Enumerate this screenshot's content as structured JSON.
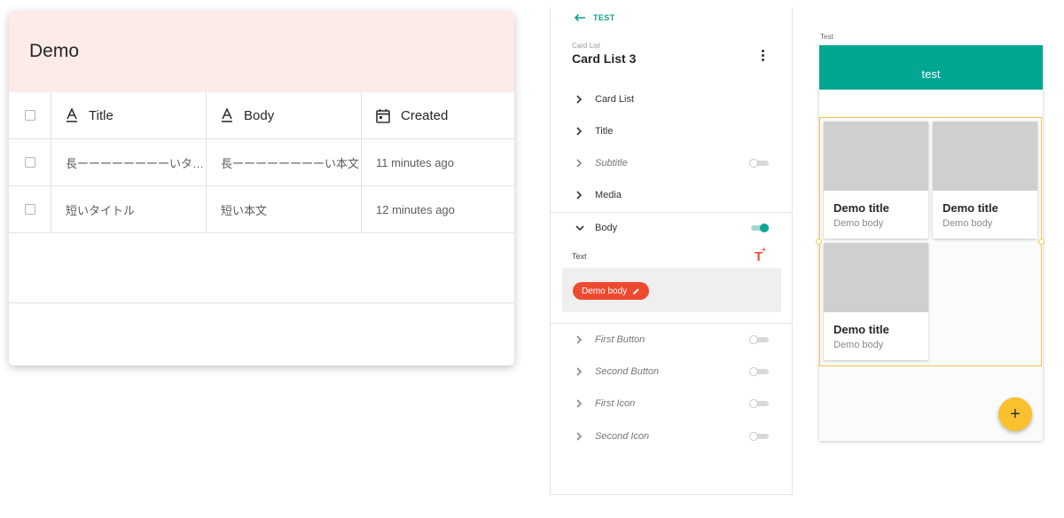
{
  "table": {
    "title": "Demo",
    "columns": [
      {
        "label": "Title",
        "icon": "text-field-icon"
      },
      {
        "label": "Body",
        "icon": "text-field-icon"
      },
      {
        "label": "Created",
        "icon": "calendar-icon"
      }
    ],
    "rows": [
      {
        "title": "長ーーーーーーーーいタ…",
        "body": "長ーーーーーーーーい本文",
        "created": "11 minutes ago"
      },
      {
        "title": "短いタイトル",
        "body": "短い本文",
        "created": "12 minutes ago"
      }
    ]
  },
  "editor": {
    "back_label": "TEST",
    "component_type": "Card List",
    "component_name": "Card List 3",
    "properties": [
      {
        "label": "Card List",
        "expanded": false,
        "disabled": false,
        "toggle": null
      },
      {
        "label": "Title",
        "expanded": false,
        "disabled": false,
        "toggle": null
      },
      {
        "label": "Subtitle",
        "expanded": false,
        "disabled": true,
        "toggle": "off"
      },
      {
        "label": "Media",
        "expanded": false,
        "disabled": false,
        "toggle": null
      },
      {
        "label": "Body",
        "expanded": true,
        "disabled": false,
        "toggle": "on"
      },
      {
        "label": "First Button",
        "expanded": false,
        "disabled": true,
        "toggle": "off"
      },
      {
        "label": "Second Button",
        "expanded": false,
        "disabled": true,
        "toggle": "off"
      },
      {
        "label": "First Icon",
        "expanded": false,
        "disabled": true,
        "toggle": "off"
      },
      {
        "label": "Second Icon",
        "expanded": false,
        "disabled": true,
        "toggle": "off"
      }
    ],
    "body_text_label": "Text",
    "body_chip": "Demo body"
  },
  "preview": {
    "screen_label": "Test",
    "app_bar_title": "test",
    "cards": [
      {
        "title": "Demo title",
        "body": "Demo body"
      },
      {
        "title": "Demo title",
        "body": "Demo body"
      },
      {
        "title": "Demo title",
        "body": "Demo body"
      }
    ],
    "fab_symbol": "+"
  },
  "colors": {
    "table_header_bg": "#fcebe8",
    "accent_teal": "#03a593",
    "chip_red": "#ef4a30",
    "selection_yellow": "#f4c550",
    "fab_yellow": "#fbc02d"
  }
}
